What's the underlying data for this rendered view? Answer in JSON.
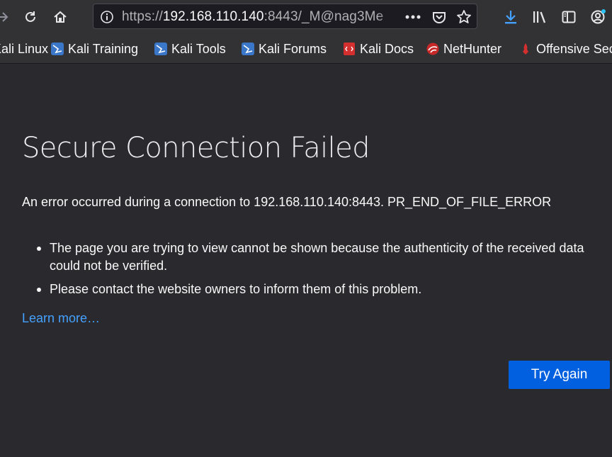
{
  "toolbar": {
    "url_scheme": "https://",
    "url_host": "192.168.110.140",
    "url_rest": ":8443/_M@nag3Me"
  },
  "bookmarks": [
    {
      "label": "Kali Linux",
      "icon": "kali-dragon-icon",
      "color": "#4a8cd8"
    },
    {
      "label": "Kali Training",
      "icon": "kali-dragon-icon",
      "color": "#4a8cd8"
    },
    {
      "label": "Kali Tools",
      "icon": "kali-dragon-icon",
      "color": "#4a8cd8"
    },
    {
      "label": "Kali Forums",
      "icon": "kali-dragon-icon",
      "color": "#4a8cd8"
    },
    {
      "label": "Kali Docs",
      "icon": "docs-icon",
      "color": "#d32f2f"
    },
    {
      "label": "NetHunter",
      "icon": "nethunter-icon",
      "color": "#c62828"
    },
    {
      "label": "Offensive Security",
      "icon": "offsec-icon",
      "color": "#d32f2f"
    }
  ],
  "error": {
    "title": "Secure Connection Failed",
    "description": "An error occurred during a connection to 192.168.110.140:8443. PR_END_OF_FILE_ERROR",
    "bullets": [
      "The page you are trying to view cannot be shown because the authenticity of the received data could not be verified.",
      "Please contact the website owners to inform them of this problem."
    ],
    "learn_more": "Learn more…",
    "try_again": "Try Again"
  },
  "colors": {
    "background": "#2a2a2e",
    "toolbar": "#323234",
    "button": "#0060df",
    "link": "#45a1ff",
    "download_accent": "#45a1ff"
  }
}
